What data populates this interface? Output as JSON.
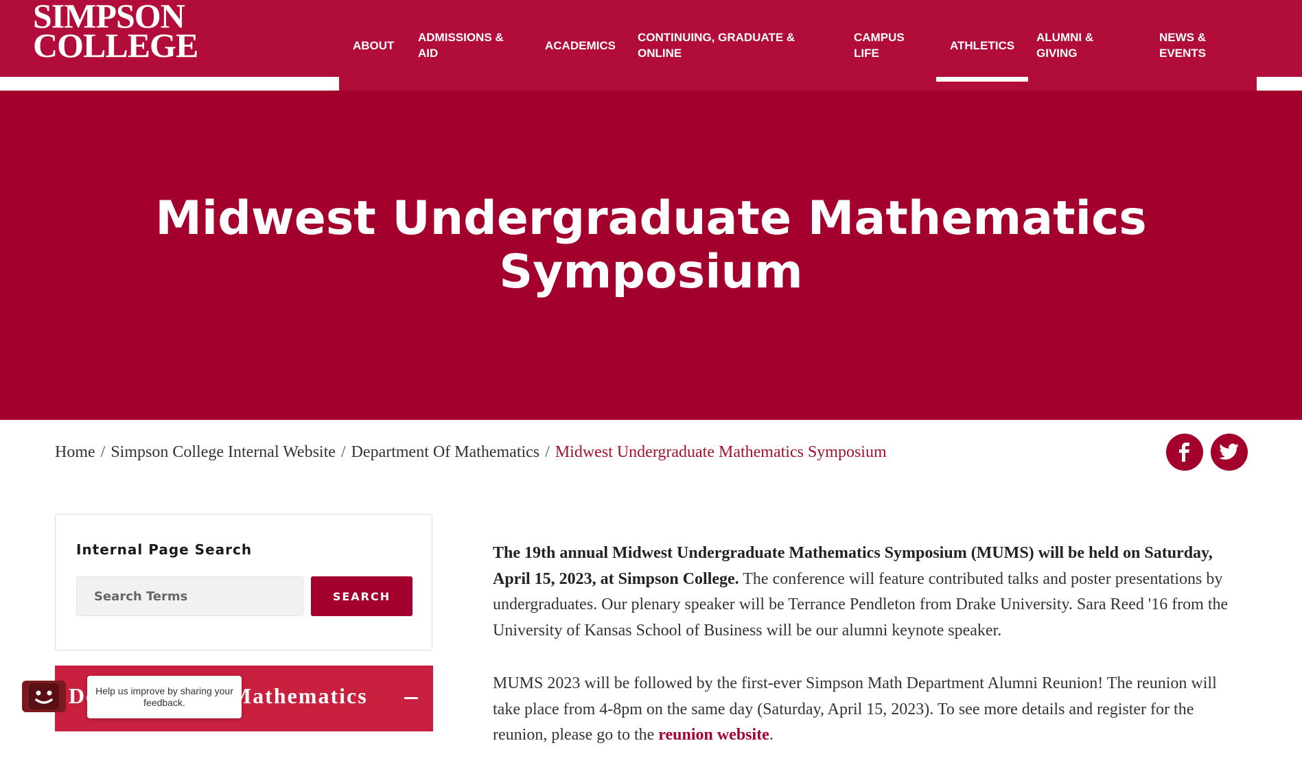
{
  "header": {
    "logo_line1": "SIMPSON",
    "logo_line2": "COLLEGE",
    "nav": [
      {
        "line1": "ABOUT",
        "line2": ""
      },
      {
        "line1": "ADMISSIONS &",
        "line2": "AID"
      },
      {
        "line1": "ACADEMICS",
        "line2": ""
      },
      {
        "line1": "CONTINUING, GRADUATE &",
        "line2": "ONLINE"
      },
      {
        "line1": "CAMPUS",
        "line2": "LIFE"
      },
      {
        "line1": "ATHLETICS",
        "line2": ""
      },
      {
        "line1": "ALUMNI &",
        "line2": "GIVING"
      },
      {
        "line1": "NEWS &",
        "line2": "EVENTS"
      }
    ]
  },
  "hero": {
    "title": "Midwest Undergraduate Mathematics Symposium"
  },
  "breadcrumb": {
    "items": [
      "Home",
      "Simpson College Internal Website",
      "Department Of Mathematics"
    ],
    "separator": "/",
    "current": "Midwest Undergraduate Mathematics Symposium"
  },
  "social": {
    "icons": [
      "facebook-icon",
      "twitter-icon"
    ]
  },
  "sidebar": {
    "search_title": "Internal Page Search",
    "search_placeholder": "Search Terms",
    "search_button": "SEARCH",
    "dept_label": "Department of Mathematics",
    "feedback_text": "Help us improve by sharing your feedback."
  },
  "article": {
    "p1_bold": "The 19th annual Midwest Undergraduate Mathematics Symposium (MUMS) will be held on Saturday, April 15, 2023, at Simpson College.",
    "p1_rest": " The conference will feature contributed talks and poster presentations by undergraduates.  Our plenary speaker will be Terrance Pendleton from Drake University.  Sara Reed '16 from the University of Kansas School of Business will be our alumni keynote speaker.",
    "p2_text": "MUMS 2023 will be followed by the first-ever Simpson Math Department Alumni Reunion!  The reunion will take place from 4-8pm on the same day (Saturday, April 15, 2023).  To see more details and register for the reunion, please go to the ",
    "p2_link": "reunion website",
    "p2_end": "."
  },
  "colors": {
    "brand": "#b10c3a",
    "hero": "#a3002e",
    "dept_bar": "#c8203e",
    "current_crumb": "#a3112f"
  }
}
